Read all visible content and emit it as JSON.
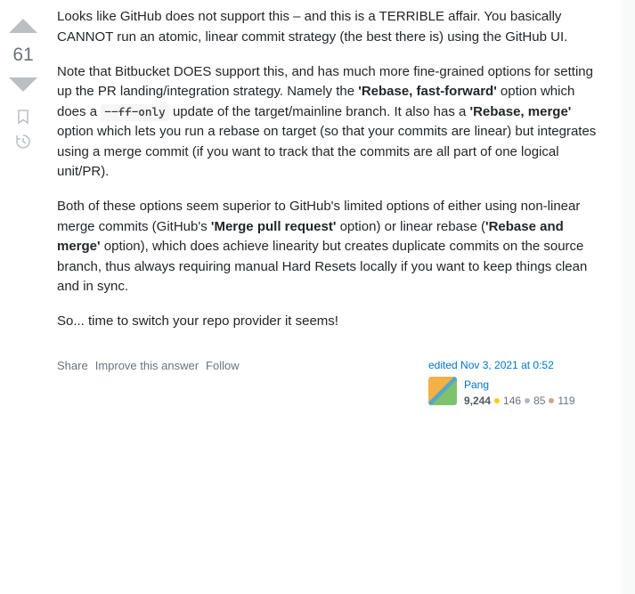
{
  "vote": {
    "score": "61"
  },
  "body": {
    "p1": "Looks like GitHub does not support this – and this is a TERRIBLE affair. You basically CANNOT run an atomic, linear commit strategy (the best there is) using the GitHub UI.",
    "p2_a": "Note that Bitbucket DOES support this, and has much more fine-grained options for setting up the PR landing/integration strategy. Namely the ",
    "p2_bold1": "'Rebase, fast-forward'",
    "p2_b": " option which does a ",
    "p2_code": "--ff-only",
    "p2_c": " update of the target/mainline branch. It also has a ",
    "p2_bold2": "'Rebase, merge'",
    "p2_d": " option which lets you run a rebase on target (so that your commits are linear) but integrates using a merge commit (if you want to track that the commits are all part of one logical unit/PR).",
    "p3_a": "Both of these options seem superior to GitHub's limited options of either using non-linear merge commits (GitHub's ",
    "p3_bold1": "'Merge pull request'",
    "p3_b": " option) or linear rebase (",
    "p3_bold2": "'Rebase and merge'",
    "p3_c": " option), which does achieve linearity but creates duplicate commits on the source branch, thus always requiring manual Hard Resets locally if you want to keep things clean and in sync.",
    "p4": "So... time to switch your repo provider it seems!"
  },
  "menu": {
    "share": "Share",
    "improve": "Improve this answer",
    "follow": "Follow"
  },
  "editor": {
    "action_prefix": "edited ",
    "action_time": "Nov 3, 2021 at 0:52",
    "name": "Pang",
    "reputation": "9,244",
    "gold_count": "146",
    "silver_count": "85",
    "bronze_count": "119"
  }
}
